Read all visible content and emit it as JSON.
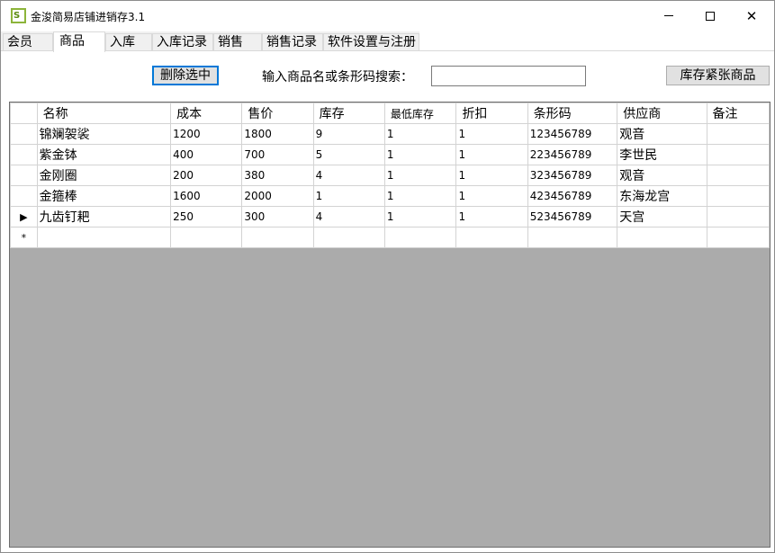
{
  "window": {
    "title": "金浚简易店铺进销存3.1",
    "icon_glyph": "S"
  },
  "tabs": [
    {
      "label": "会员"
    },
    {
      "label": "商品"
    },
    {
      "label": "入库"
    },
    {
      "label": "入库记录"
    },
    {
      "label": "销售"
    },
    {
      "label": "销售记录"
    },
    {
      "label": "软件设置与注册"
    }
  ],
  "active_tab": "商品",
  "toolbar": {
    "delete_label": "删除选中",
    "search_label": "输入商品名或条形码搜索：",
    "search_value": "",
    "low_stock_label": "库存紧张商品"
  },
  "grid": {
    "columns": [
      "名称",
      "成本",
      "售价",
      "库存",
      "最低库存",
      "折扣",
      "条形码",
      "供应商",
      "备注"
    ],
    "rows": [
      {
        "marker": "",
        "cells": [
          "锦斓袈裟",
          "1200",
          "1800",
          "9",
          "1",
          "1",
          "123456789",
          "观音",
          ""
        ]
      },
      {
        "marker": "",
        "cells": [
          "紫金钵",
          "400",
          "700",
          "5",
          "1",
          "1",
          "223456789",
          "李世民",
          ""
        ]
      },
      {
        "marker": "",
        "cells": [
          "金刚圈",
          "200",
          "380",
          "4",
          "1",
          "1",
          "323456789",
          "观音",
          ""
        ]
      },
      {
        "marker": "",
        "cells": [
          "金箍棒",
          "1600",
          "2000",
          "1",
          "1",
          "1",
          "423456789",
          "东海龙宫",
          ""
        ]
      },
      {
        "marker": "▶",
        "cells": [
          "九齿钉耙",
          "250",
          "300",
          "4",
          "1",
          "1",
          "523456789",
          "天宫",
          ""
        ]
      }
    ],
    "new_row_marker": "*"
  }
}
